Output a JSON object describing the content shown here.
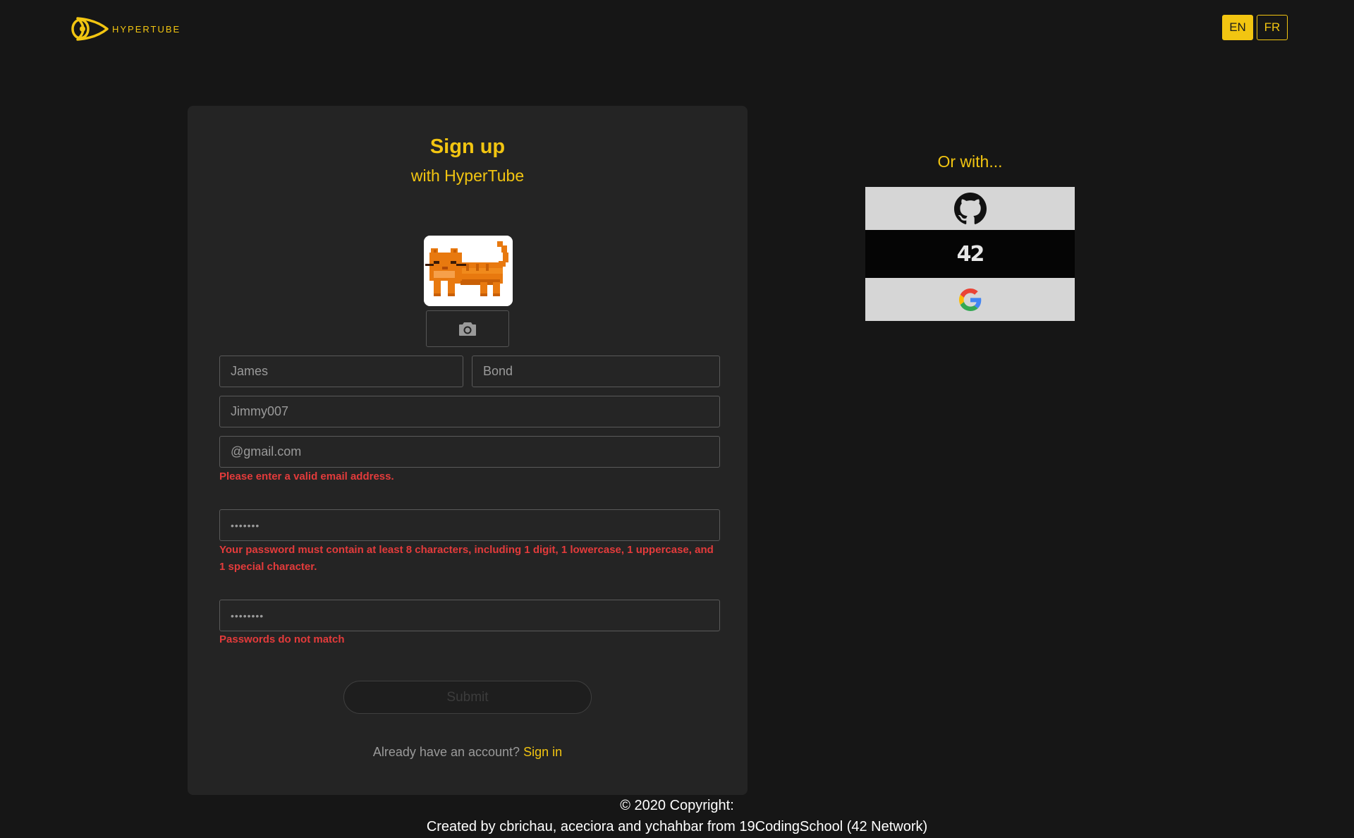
{
  "header": {
    "logo_text": "HYPERTUBE",
    "languages": [
      "EN",
      "FR"
    ],
    "active_language": "EN"
  },
  "signup": {
    "title": "Sign up",
    "subtitle": "with HyperTube",
    "fields": {
      "first_name": "James",
      "last_name": "Bond",
      "username": "Jimmy007",
      "email": "@gmail.com",
      "password": "•••••••",
      "confirm_password": "••••••••"
    },
    "errors": {
      "email": "Please enter a valid email address.",
      "password": "Your password must contain at least 8 characters, including 1 digit, 1 lowercase, 1 uppercase, and 1 special character.",
      "confirm": "Passwords do not match"
    },
    "submit_label": "Submit",
    "already_text": "Already have an account?",
    "signin_label": "Sign in"
  },
  "oauth": {
    "heading": "Or with...",
    "providers": [
      "github-icon",
      "42-icon",
      "google-icon"
    ],
    "provider_42_text": "42"
  },
  "footer": {
    "line1": "© 2020 Copyright:",
    "line2": "Created by cbrichau, aceciora and ychahbar from 19CodingSchool (42 Network)"
  },
  "colors": {
    "accent": "#f2c511",
    "background": "#161616",
    "card": "#242424",
    "error": "#e33b3b"
  }
}
